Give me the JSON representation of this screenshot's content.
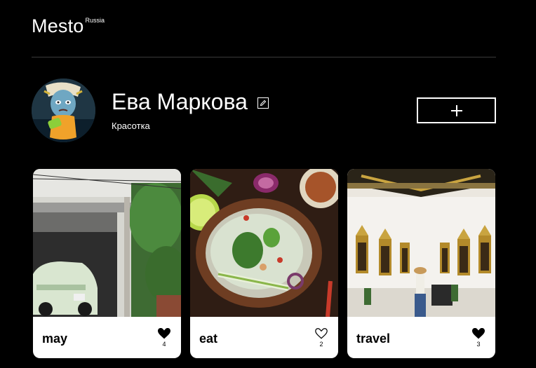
{
  "header": {
    "logo_main": "Mesto",
    "logo_sub": "Russia"
  },
  "profile": {
    "name": "Ева Маркова",
    "description": "Красотка",
    "add_button_icon": "plus-icon",
    "edit_button_icon": "pencil-icon"
  },
  "cards": [
    {
      "title": "may",
      "likes": "4",
      "liked": true,
      "image": "street-car-photo"
    },
    {
      "title": "eat",
      "likes": "2",
      "liked": false,
      "image": "thai-food-photo"
    },
    {
      "title": "travel",
      "likes": "3",
      "liked": true,
      "image": "temple-travel-photo"
    }
  ],
  "colors": {
    "background": "#000000",
    "card": "#ffffff",
    "text": "#ffffff",
    "card_text": "#000000"
  }
}
